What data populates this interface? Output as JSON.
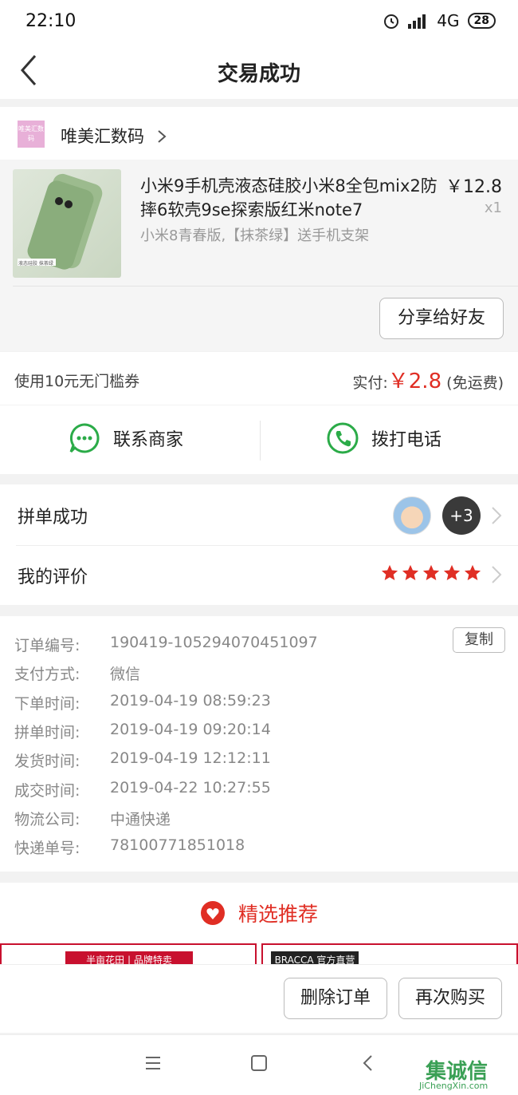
{
  "status": {
    "time": "22:10",
    "network": "4G",
    "battery": "28"
  },
  "header": {
    "title": "交易成功"
  },
  "store": {
    "logo_text": "唯美汇数码",
    "name": "唯美汇数码"
  },
  "product": {
    "title": "小米9手机壳液态硅胶小米8全包mix2防摔6软壳9se探索版红米note7",
    "spec": "小米8青春版,【抹茶绿】送手机支架",
    "price": "￥12.8",
    "qty": "x1",
    "img_badge": "液态硅胶 抹茶绿",
    "share_label": "分享给好友"
  },
  "payment": {
    "coupon": "使用10元无门槛券",
    "paid_label": "实付:",
    "paid_amount": "￥2.8",
    "shipping_note": "(免运费)"
  },
  "contact": {
    "merchant_label": "联系商家",
    "call_label": "拨打电话"
  },
  "group": {
    "status_label": "拼单成功",
    "extra_count": "+3",
    "review_label": "我的评价",
    "rating": 5
  },
  "order": {
    "copy_label": "复制",
    "rows": [
      {
        "label": "订单编号:",
        "value": "190419-105294070451097"
      },
      {
        "label": "支付方式:",
        "value": "微信"
      },
      {
        "label": "下单时间:",
        "value": "2019-04-19 08:59:23"
      },
      {
        "label": "拼单时间:",
        "value": "2019-04-19 09:20:14"
      },
      {
        "label": "发货时间:",
        "value": "2019-04-19 12:12:11"
      },
      {
        "label": "成交时间:",
        "value": "2019-04-22 10:27:55"
      },
      {
        "label": "物流公司:",
        "value": "中通快递"
      },
      {
        "label": "快递单号:",
        "value": "78100771851018"
      }
    ]
  },
  "recommend": {
    "title": "精选推荐",
    "item1_text": "半亩花田 | 品牌特卖",
    "item2_text": "BRACCA 官方直营"
  },
  "actions": {
    "delete_label": "删除订单",
    "rebuy_label": "再次购买"
  },
  "watermark": {
    "text": "集诚信",
    "sub": "JiChengXin.com"
  },
  "colors": {
    "accent": "#e02e24",
    "green": "#2bab48"
  }
}
